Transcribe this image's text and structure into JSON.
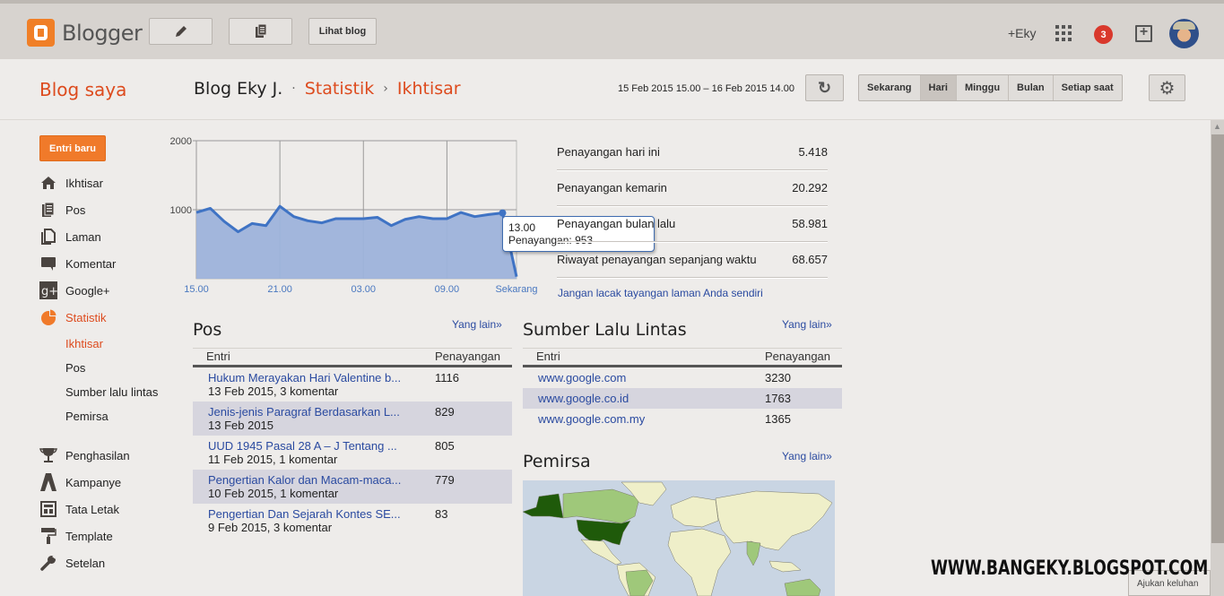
{
  "topbar": {
    "app_name": "Blogger",
    "view_blog_label": "Lihat blog",
    "user_label": "+Eky",
    "notification_count": "3",
    "icons": {
      "new_post": "pencil-icon",
      "posts": "posts-icon",
      "apps": "apps-grid-icon",
      "share": "share-box-icon"
    }
  },
  "subheader": {
    "my_blogs": "Blog saya",
    "blog_name": "Blog Eky J.",
    "separator": "·",
    "section": "Statistik",
    "chevron": "›",
    "page": "Ikhtisar",
    "date_range": "15 Feb 2015 15.00 – 16 Feb 2015 14.00",
    "range_options": [
      "Sekarang",
      "Hari",
      "Minggu",
      "Bulan",
      "Setiap saat"
    ],
    "selected_range": "Hari"
  },
  "sidebar": {
    "new_post_label": "Entri baru",
    "items": [
      {
        "label": "Ikhtisar",
        "icon": "home-icon"
      },
      {
        "label": "Pos",
        "icon": "posts-icon"
      },
      {
        "label": "Laman",
        "icon": "pages-icon"
      },
      {
        "label": "Komentar",
        "icon": "comment-icon"
      },
      {
        "label": "Google+",
        "icon": "google-plus-icon"
      },
      {
        "label": "Statistik",
        "icon": "pie-chart-icon",
        "active": true
      }
    ],
    "sub_items": [
      {
        "label": "Ikhtisar",
        "active": true
      },
      {
        "label": "Pos"
      },
      {
        "label": "Sumber lalu lintas"
      },
      {
        "label": "Pemirsa"
      }
    ],
    "items2": [
      {
        "label": "Penghasilan",
        "icon": "trophy-icon"
      },
      {
        "label": "Kampanye",
        "icon": "campaign-icon"
      },
      {
        "label": "Tata Letak",
        "icon": "layout-icon"
      },
      {
        "label": "Template",
        "icon": "paint-roller-icon"
      },
      {
        "label": "Setelan",
        "icon": "wrench-icon"
      }
    ]
  },
  "chart_data": {
    "type": "area",
    "title": "",
    "xlabel": "",
    "ylabel": "",
    "ylim": [
      0,
      2000
    ],
    "yticks": [
      "2000",
      "1000"
    ],
    "xtick_labels": [
      "15.00",
      "21.00",
      "03.00",
      "09.00",
      "Sekarang"
    ],
    "x": [
      "15.00",
      "16.00",
      "17.00",
      "18.00",
      "19.00",
      "20.00",
      "21.00",
      "22.00",
      "23.00",
      "00.00",
      "01.00",
      "02.00",
      "03.00",
      "04.00",
      "05.00",
      "06.00",
      "07.00",
      "08.00",
      "09.00",
      "10.00",
      "11.00",
      "12.00",
      "13.00",
      "14.00"
    ],
    "series": [
      {
        "name": "Penayangan",
        "values": [
          960,
          1020,
          830,
          680,
          800,
          770,
          1050,
          900,
          840,
          810,
          870,
          870,
          870,
          890,
          770,
          860,
          900,
          870,
          870,
          960,
          900,
          930,
          953,
          30
        ]
      }
    ],
    "grid": true,
    "color": "#3f73c4",
    "fill": "#9db3db",
    "highlight": {
      "x": "13.00",
      "label": "Penayangan",
      "value": 953
    }
  },
  "tooltip": {
    "time": "13.00",
    "text": "Penayangan: 953"
  },
  "stats": [
    {
      "label": "Penayangan hari ini",
      "value": "5.418"
    },
    {
      "label": "Penayangan kemarin",
      "value": "20.292"
    },
    {
      "label": "Penayangan bulan lalu",
      "value": "58.981"
    },
    {
      "label": "Riwayat penayangan sepanjang waktu",
      "value": "68.657"
    }
  ],
  "track_link": "Jangan lacak tayangan laman Anda sendiri",
  "posts_panel": {
    "title": "Pos",
    "more": "Yang lain»",
    "columns": [
      "Entri",
      "Penayangan"
    ],
    "rows": [
      {
        "title": "Hukum Merayakan Hari Valentine b...",
        "meta": "13 Feb 2015, 3 komentar",
        "views": "1116"
      },
      {
        "title": "Jenis-jenis Paragraf Berdasarkan L...",
        "meta": "13 Feb 2015",
        "views": "829"
      },
      {
        "title": "UUD 1945 Pasal 28 A – J Tentang ...",
        "meta": "11 Feb 2015, 1 komentar",
        "views": "805"
      },
      {
        "title": "Pengertian Kalor dan Macam-maca...",
        "meta": "10 Feb 2015, 1 komentar",
        "views": "779"
      },
      {
        "title": "Pengertian Dan Sejarah Kontes SE...",
        "meta": "9 Feb 2015, 3 komentar",
        "views": "83"
      }
    ]
  },
  "traffic_panel": {
    "title": "Sumber Lalu Lintas",
    "more": "Yang lain»",
    "columns": [
      "Entri",
      "Penayangan"
    ],
    "rows": [
      {
        "source": "www.google.com",
        "views": "3230"
      },
      {
        "source": "www.google.co.id",
        "views": "1763"
      },
      {
        "source": "www.google.com.my",
        "views": "1365"
      }
    ]
  },
  "audience_panel": {
    "title": "Pemirsa",
    "more": "Yang lain»"
  },
  "watermark": "WWW.BANGEKY.BLOGSPOT.COM",
  "feedback_label": "Ajukan keluhan"
}
